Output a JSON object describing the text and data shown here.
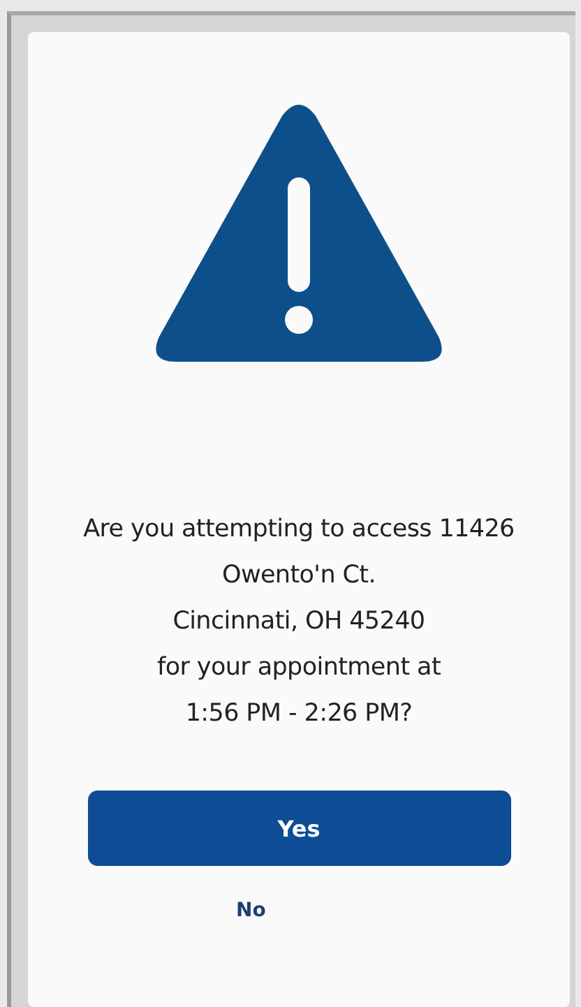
{
  "dialog": {
    "message_lines": [
      "Are you attempting to access 11426",
      "Owento'n Ct.",
      "Cincinnati, OH 45240",
      "for your appointment at",
      "1:56 PM - 2:26 PM?"
    ],
    "buttons": [
      {
        "label": "Yes",
        "kind": "primary"
      },
      {
        "label": "No",
        "kind": "link"
      }
    ]
  }
}
